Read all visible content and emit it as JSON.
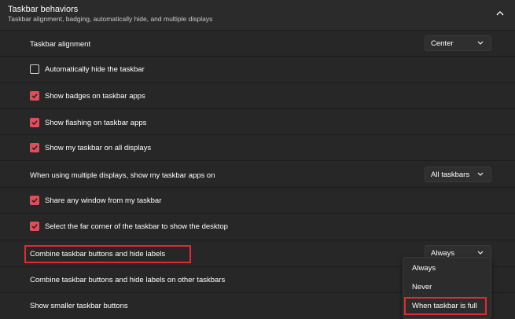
{
  "section": {
    "title": "Taskbar behaviors",
    "subtitle": "Taskbar alignment, badging, automatically hide, and multiple displays",
    "collapse_icon": "chevron-up-icon"
  },
  "settings": {
    "alignment": {
      "label": "Taskbar alignment",
      "value": "Center"
    },
    "auto_hide": {
      "label": "Automatically hide the taskbar",
      "checked": false
    },
    "badges": {
      "label": "Show badges on taskbar apps",
      "checked": true
    },
    "flashing": {
      "label": "Show flashing on taskbar apps",
      "checked": true
    },
    "all_displays": {
      "label": "Show my taskbar on all displays",
      "checked": true
    },
    "multi_display": {
      "label": "When using multiple displays, show my taskbar apps on",
      "value": "All taskbars"
    },
    "share_window": {
      "label": "Share any window from my taskbar",
      "checked": true
    },
    "far_corner": {
      "label": "Select the far corner of the taskbar to show the desktop",
      "checked": true
    },
    "combine": {
      "label": "Combine taskbar buttons and hide labels",
      "value": "Always"
    },
    "combine_other": {
      "label": "Combine taskbar buttons and hide labels on other taskbars"
    },
    "smaller_buttons": {
      "label": "Show smaller taskbar buttons"
    }
  },
  "menu": {
    "items": [
      "Always",
      "Never",
      "When taskbar is full"
    ]
  },
  "colors": {
    "accent": "#e04e5b",
    "highlight": "#e02a35",
    "background": "#202020"
  }
}
